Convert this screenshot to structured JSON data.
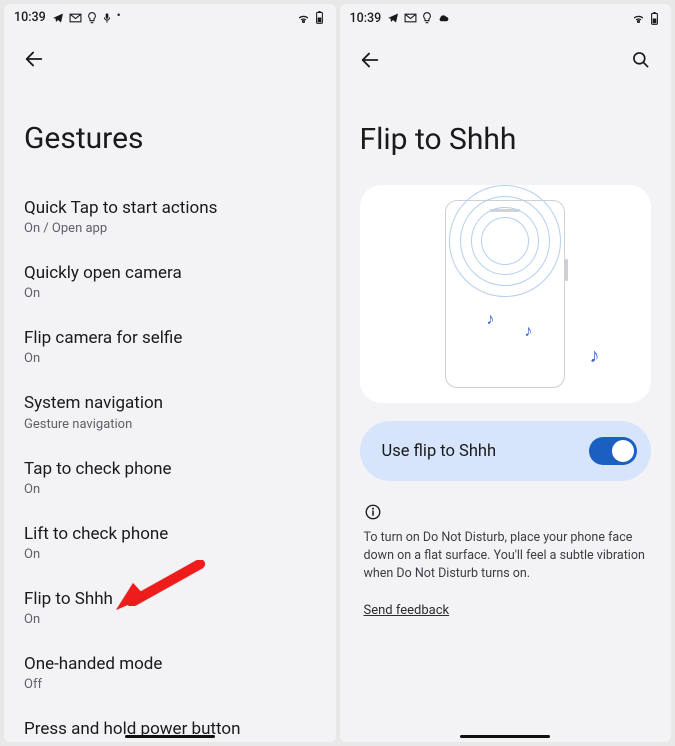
{
  "left": {
    "status_time": "10:39",
    "page_title": "Gestures",
    "items": [
      {
        "title": "Quick Tap to start actions",
        "sub": "On / Open app"
      },
      {
        "title": "Quickly open camera",
        "sub": "On"
      },
      {
        "title": "Flip camera for selfie",
        "sub": "On"
      },
      {
        "title": "System navigation",
        "sub": "Gesture navigation"
      },
      {
        "title": "Tap to check phone",
        "sub": "On"
      },
      {
        "title": "Lift to check phone",
        "sub": "On"
      },
      {
        "title": "Flip to Shhh",
        "sub": "On"
      },
      {
        "title": "One-handed mode",
        "sub": "Off"
      },
      {
        "title": "Press and hold power button",
        "sub": ""
      }
    ]
  },
  "right": {
    "status_time": "10:39",
    "page_title": "Flip to Shhh",
    "toggle_label": "Use flip to Shhh",
    "info_text": "To turn on Do Not Disturb, place your phone face down on a flat surface. You'll feel a subtle vibration when Do Not Disturb turns on.",
    "feedback_link": "Send feedback"
  }
}
